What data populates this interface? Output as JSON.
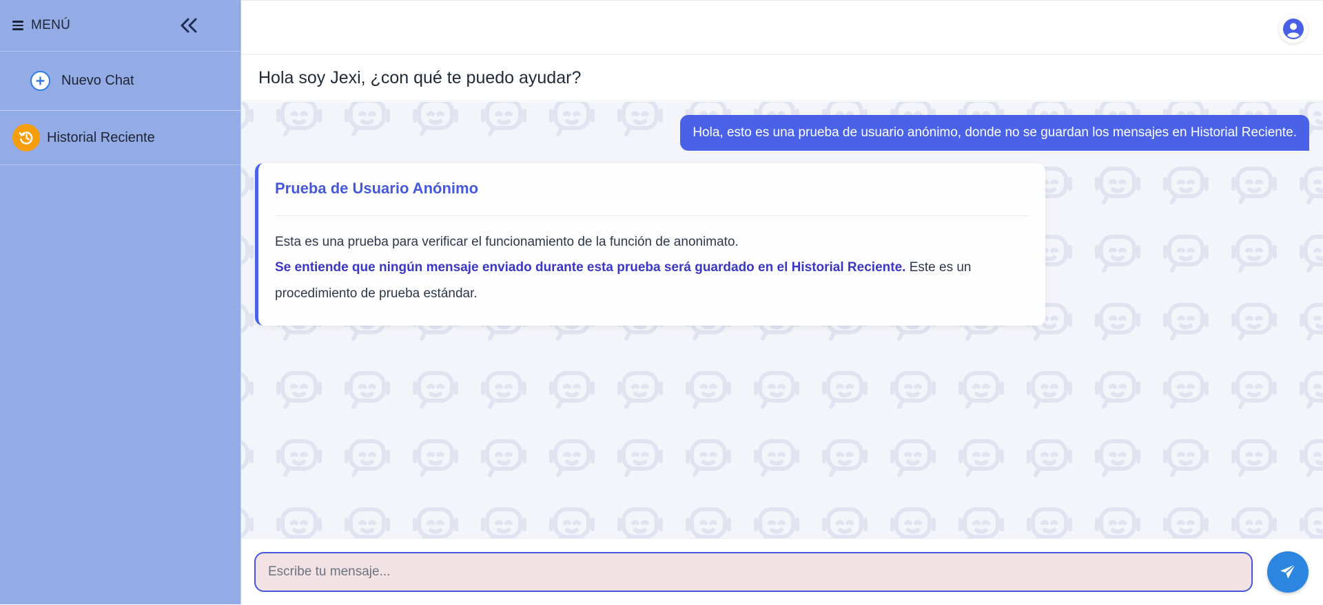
{
  "sidebar": {
    "menu_title": "MENÚ",
    "items": [
      {
        "label": "Nuevo Chat",
        "icon": "plus-circle-icon"
      },
      {
        "label": "Historial Reciente",
        "icon": "history-icon"
      }
    ]
  },
  "header": {
    "title": "Hola soy Jexi, ¿con qué te puedo ayudar?"
  },
  "messages": {
    "user": "Hola, esto es una prueba de usuario anónimo, donde no se guardan los mensajes en Historial Reciente.",
    "bot": {
      "title": "Prueba de Usuario Anónimo",
      "line1": "Esta es una prueba para verificar el funcionamiento de la función de anonimato.",
      "bold": "Se entiende que ningún mensaje enviado durante esta prueba será guardado en el Historial Reciente.",
      "rest": " Este es un procedimiento de prueba estándar."
    }
  },
  "composer": {
    "placeholder": "Escribe tu mensaje...",
    "value": ""
  },
  "colors": {
    "sidebar_bg": "#93ace6",
    "accent": "#4a62e8",
    "history_icon": "#f59e0b",
    "send_button": "#2c86e0",
    "input_bg": "#f2e2e4"
  }
}
